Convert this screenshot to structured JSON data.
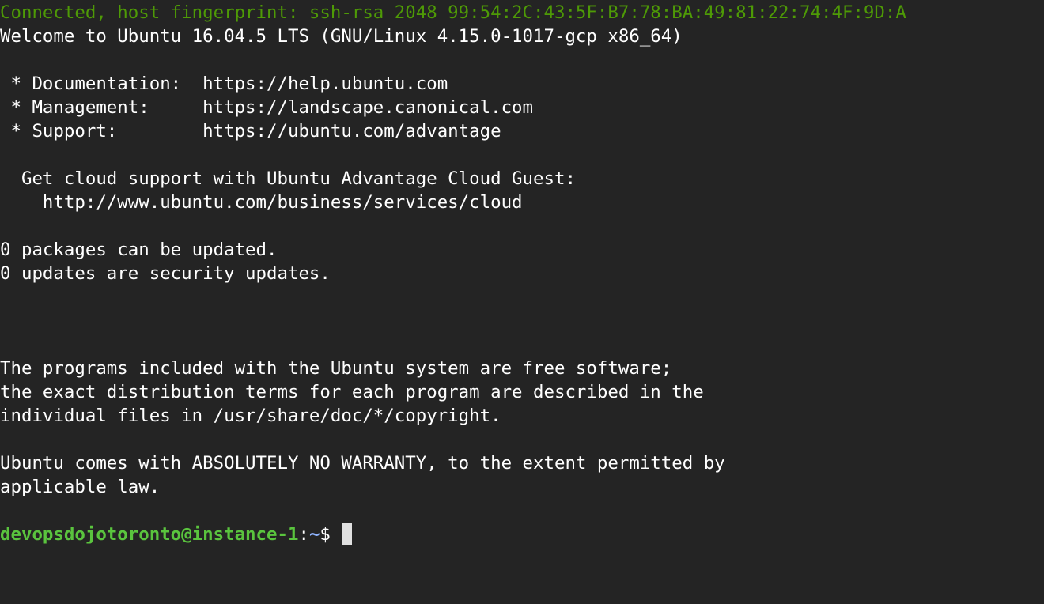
{
  "terminal": {
    "lines": [
      "Connected, host fingerprint: ssh-rsa 2048 99:54:2C:43:5F:B7:78:BA:49:81:22:74:4F:9D:A",
      "Welcome to Ubuntu 16.04.5 LTS (GNU/Linux 4.15.0-1017-gcp x86_64)",
      "",
      " * Documentation:  https://help.ubuntu.com",
      " * Management:     https://landscape.canonical.com",
      " * Support:        https://ubuntu.com/advantage",
      "",
      "  Get cloud support with Ubuntu Advantage Cloud Guest:",
      "    http://www.ubuntu.com/business/services/cloud",
      "",
      "0 packages can be updated.",
      "0 updates are security updates.",
      "",
      "",
      "",
      "The programs included with the Ubuntu system are free software;",
      "the exact distribution terms for each program are described in the",
      "individual files in /usr/share/doc/*/copyright.",
      "",
      "Ubuntu comes with ABSOLUTELY NO WARRANTY, to the extent permitted by",
      "applicable law.",
      ""
    ],
    "prompt": {
      "user_host": "devopsdojotoronto@instance-1",
      "separator": ":",
      "path": "~",
      "symbol": "$ "
    }
  },
  "colors": {
    "background": "#242424",
    "text": "#ffffff",
    "connected_green": "#4e9a06",
    "prompt_green": "#5ac43e",
    "prompt_path_blue": "#8fb4ff",
    "cursor": "#e0e0e0"
  }
}
